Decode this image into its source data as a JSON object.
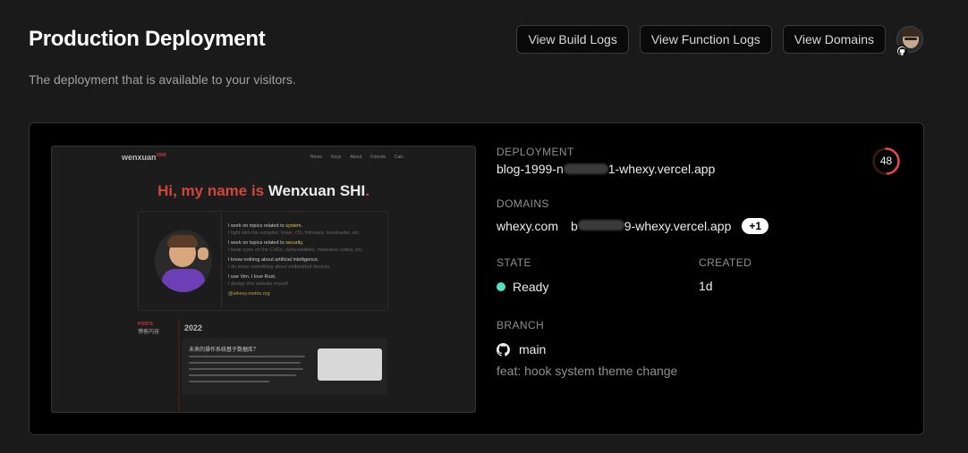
{
  "page": {
    "title": "Production Deployment",
    "subtitle": "The deployment that is available to your visitors."
  },
  "header": {
    "buttons": [
      "View Build Logs",
      "View Function Logs",
      "View Domains"
    ],
    "avatar_icon": "user-avatar-icon",
    "avatar_badge_icon": "github-icon"
  },
  "preview": {
    "logo": "wenxuan",
    "logo_sup": "1999",
    "nav": [
      "Home",
      "Keys",
      "About",
      "Friends",
      "Calc"
    ],
    "hero_red": "Hi, my name is ",
    "hero_white": "Wenxuan SHI",
    "hero_dot": ".",
    "about_lines": [
      {
        "text": "I work on topics related to ",
        "em": "system.",
        "sub": "I fight with the compiler, linker, OS, firmware, bootloader, etc."
      },
      {
        "text": "I work on topics related to ",
        "em": "security.",
        "sub": "I keep eyes on the CVEs, vulnerabilities, malicious codes, etc."
      },
      {
        "text": "I know nothing about artificial intelligence.",
        "em": "",
        "sub": "I do know something about embedded devices."
      },
      {
        "text": "I use Vim. I love Rust.",
        "em": "",
        "sub": "I design this website myself"
      }
    ],
    "link": "@whexy.metrix.org",
    "posts_label": "POSTS",
    "posts_sub": "博客内容",
    "year": "2022",
    "post_title": "未来的操作系统基于数据库？"
  },
  "deployment": {
    "label": "DEPLOYMENT",
    "url_prefix": "blog-1999-n",
    "url_suffix": "1-whexy.vercel.app",
    "score": 48,
    "score_color": "#e5484d"
  },
  "domains": {
    "label": "DOMAINS",
    "primary": "whexy.com",
    "secondary_prefix": "b",
    "secondary_suffix": "9-whexy.vercel.app",
    "more": "+1"
  },
  "state": {
    "label": "STATE",
    "value": "Ready",
    "color": "#50e3c2"
  },
  "created": {
    "label": "CREATED",
    "value": "1d"
  },
  "branch": {
    "label": "BRANCH",
    "name": "main",
    "icon": "github-icon",
    "commit_message": "feat: hook system theme change"
  }
}
